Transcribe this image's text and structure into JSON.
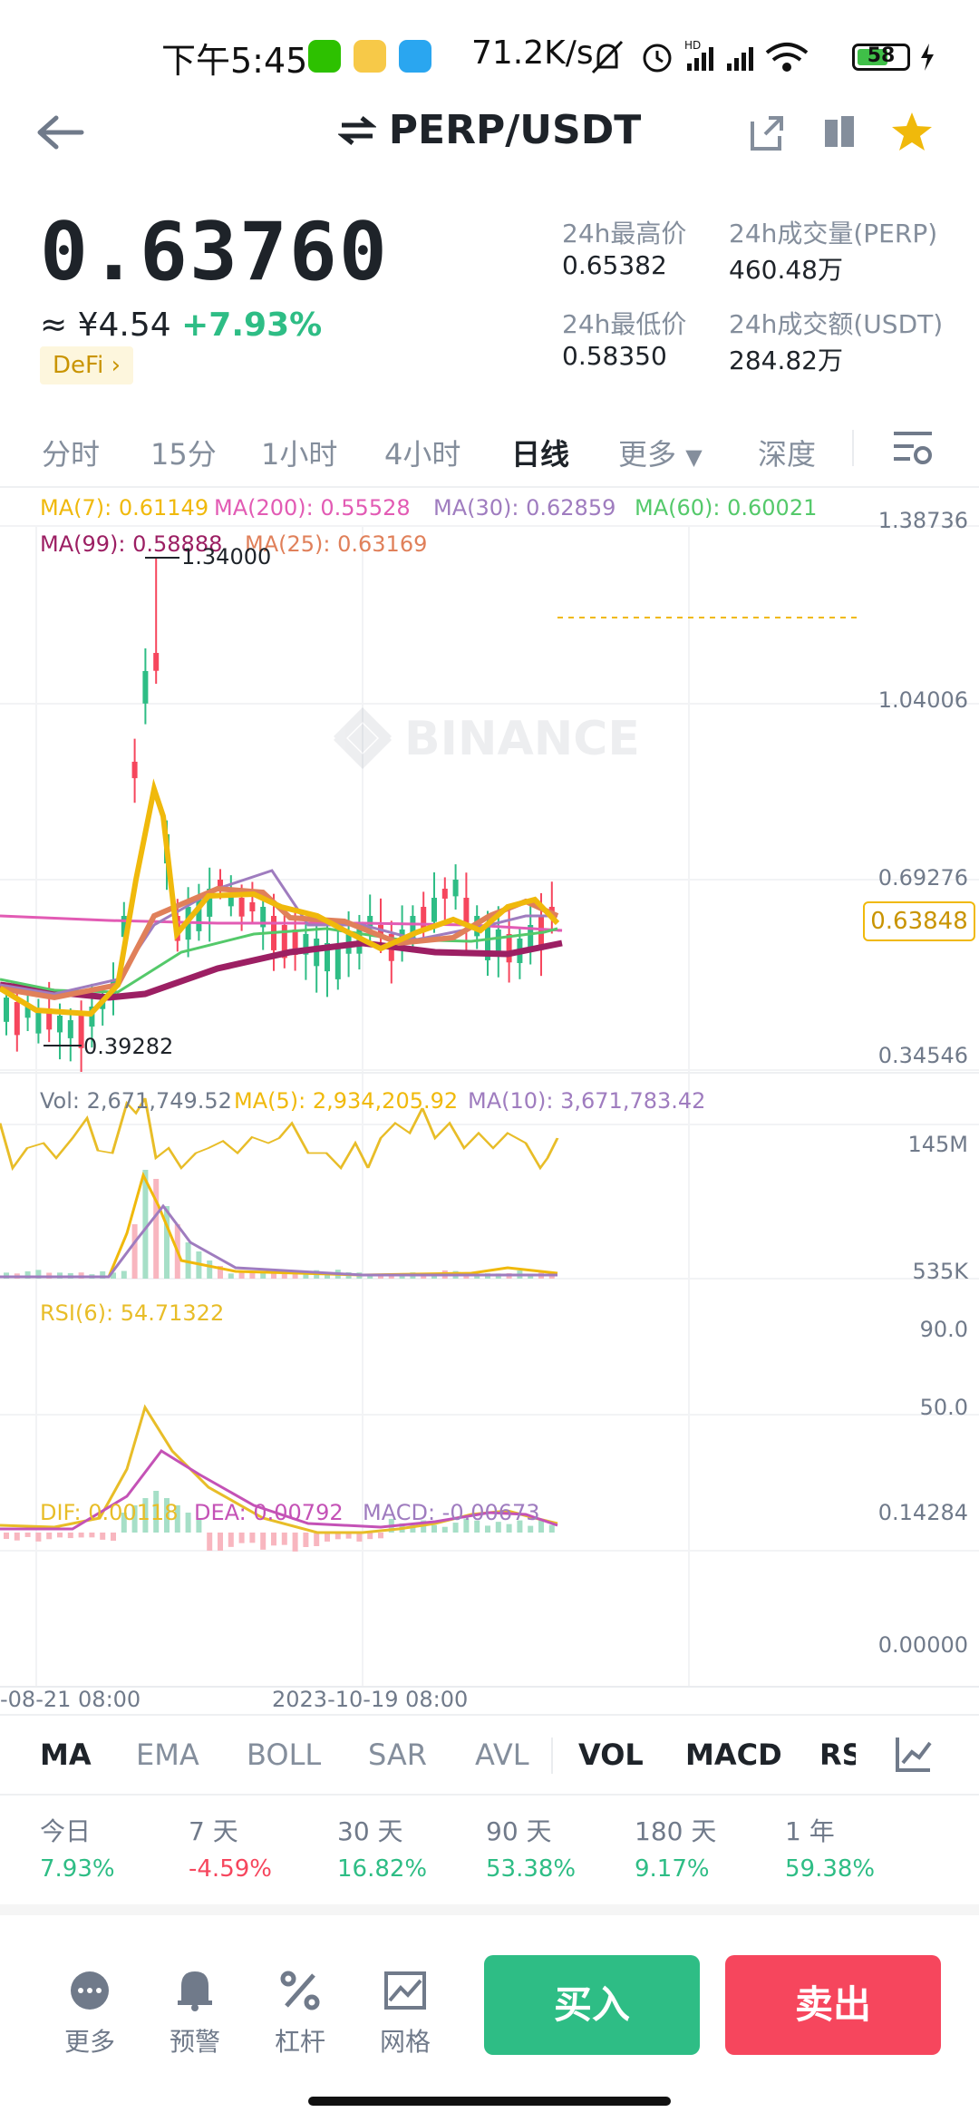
{
  "status_bar": {
    "time": "下午5:45",
    "net_speed": "71.2K/s",
    "network_badge": "HD",
    "battery": "58"
  },
  "header": {
    "title": "PERP/USDT",
    "icons": [
      "back-arrow-icon",
      "swap-icon",
      "share-icon",
      "book-icon",
      "star-icon"
    ]
  },
  "ticker": {
    "last_price": "0.63760",
    "approx_cny": "≈ ¥4.54",
    "change_pct": "+7.93%",
    "tag": "DeFi",
    "high_label": "24h最高价",
    "high": "0.65382",
    "low_label": "24h最低价",
    "low": "0.58350",
    "vol_label": "24h成交量(PERP)",
    "vol": "460.48万",
    "amount_label": "24h成交额(USDT)",
    "amount": "284.82万"
  },
  "timeframes": [
    "分时",
    "15分",
    "1小时",
    "4小时",
    "日线",
    "更多",
    "深度"
  ],
  "active_timeframe": "日线",
  "main_chart": {
    "ma": {
      "ma7": "MA(7): 0.61149",
      "ma200": "MA(200): 0.55528",
      "ma30": "MA(30): 0.62859",
      "ma60": "MA(60): 0.60021",
      "ma99": "MA(99): 0.58888",
      "ma25": "MA(25): 0.63169"
    },
    "yaxis": [
      "1.38736",
      "1.04006",
      "0.69276",
      "0.34546"
    ],
    "high_marker": "1.34000",
    "low_marker": "0.39282",
    "current_price_tag": "0.63848",
    "watermark": "BINANCE"
  },
  "volume": {
    "vol": "Vol: 2,671,749.52",
    "ma5": "MA(5): 2,934,205.92",
    "ma10": "MA(10): 3,671,783.42",
    "yaxis": [
      "145M",
      "535K"
    ]
  },
  "rsi": {
    "label": "RSI(6): 54.71322",
    "yaxis": [
      "90.0",
      "50.0"
    ]
  },
  "macd": {
    "dif": "DIF: 0.00118",
    "dea": "DEA: 0.00792",
    "macd": "MACD: -0.00673",
    "yaxis": [
      "0.14284",
      "0.00000"
    ],
    "x_left": "-08-21 08:00",
    "x_mid": "2023-10-19 08:00"
  },
  "indicator_tabs": [
    "MA",
    "EMA",
    "BOLL",
    "SAR",
    "AVL",
    "VOL",
    "MACD",
    "RS"
  ],
  "performance": [
    {
      "label": "今日",
      "value": "7.93%",
      "dir": "up"
    },
    {
      "label": "7 天",
      "value": "-4.59%",
      "dir": "down"
    },
    {
      "label": "30 天",
      "value": "16.82%",
      "dir": "up"
    },
    {
      "label": "90 天",
      "value": "53.38%",
      "dir": "up"
    },
    {
      "label": "180 天",
      "value": "9.17%",
      "dir": "up"
    },
    {
      "label": "1 年",
      "value": "59.38%",
      "dir": "up"
    }
  ],
  "bottom_bar": {
    "more": "更多",
    "alert": "预警",
    "leverage": "杠杆",
    "grid": "网格",
    "buy": "买入",
    "sell": "卖出"
  },
  "colors": {
    "up": "#2ebd85",
    "down": "#f6465d",
    "accent": "#f0b90b"
  }
}
